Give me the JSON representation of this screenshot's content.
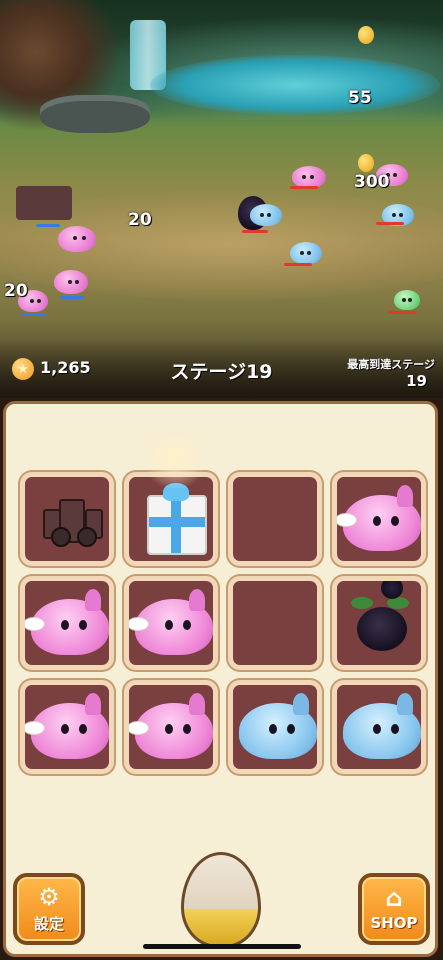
{
  "hud": {
    "coins": "1,265",
    "stage_title": "ステージ19",
    "best_stage_label": "最高到達ステージ",
    "best_stage_value": "19"
  },
  "battle_numbers": [
    "55",
    "300",
    "20",
    "20"
  ],
  "board": {
    "rows": [
      [
        "barricade",
        "gift",
        "empty",
        "pink-slime"
      ],
      [
        "pink-slime",
        "pink-slime",
        "empty",
        "dark-plant"
      ],
      [
        "pink-slime",
        "pink-slime",
        "blue-slime",
        "blue-slime"
      ]
    ]
  },
  "controls": {
    "settings_label": "設定",
    "shop_label": "SHOP",
    "settings_icon": "gear-icon",
    "shop_icon": "home-icon",
    "egg_fill_percent": 40
  },
  "colors": {
    "board_bg": "#f7eed6",
    "cell_bg": "#7a3f3f",
    "button_orange": "#f5a030"
  }
}
